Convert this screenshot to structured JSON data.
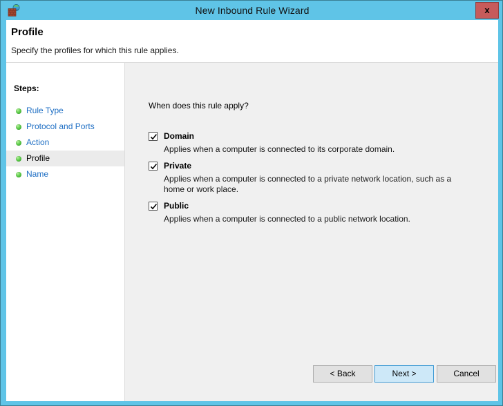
{
  "window": {
    "title": "New Inbound Rule Wizard",
    "icon": "firewall-brick-wall-globe-icon",
    "close_label": "x",
    "accent_color": "#5fc4e7",
    "close_color": "#c75b5b"
  },
  "header": {
    "title": "Profile",
    "subtitle": "Specify the profiles for which this rule applies."
  },
  "sidebar": {
    "title": "Steps:",
    "items": [
      {
        "label": "Rule Type",
        "active": false
      },
      {
        "label": "Protocol and Ports",
        "active": false
      },
      {
        "label": "Action",
        "active": false
      },
      {
        "label": "Profile",
        "active": true
      },
      {
        "label": "Name",
        "active": false
      }
    ],
    "bullet_color": "#5ecd4b",
    "link_color": "#1f6fc4"
  },
  "content": {
    "question": "When does this rule apply?",
    "options": [
      {
        "label": "Domain",
        "checked": true,
        "description": "Applies when a computer is connected to its corporate domain."
      },
      {
        "label": "Private",
        "checked": true,
        "description": "Applies when a computer is connected to a private network location, such as a home or work place."
      },
      {
        "label": "Public",
        "checked": true,
        "description": "Applies when a computer is connected to a public network location."
      }
    ]
  },
  "footer": {
    "back_label": "< Back",
    "next_label": "Next >",
    "cancel_label": "Cancel",
    "default_button": "Next >"
  }
}
